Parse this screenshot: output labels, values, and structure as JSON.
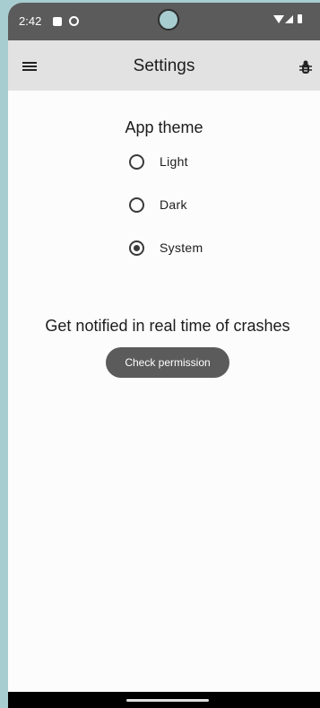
{
  "status_bar": {
    "time": "2:42",
    "icons": [
      "sd-card-icon",
      "sync-icon",
      "wifi-icon",
      "signal-icon",
      "battery-icon"
    ]
  },
  "app_bar": {
    "title": "Settings",
    "icons": [
      "menu-icon",
      "bug-icon"
    ]
  },
  "theme": {
    "title": "App theme",
    "options": [
      {
        "label": "Light",
        "selected": false
      },
      {
        "label": "Dark",
        "selected": false
      },
      {
        "label": "System",
        "selected": true
      }
    ]
  },
  "notifications": {
    "text": "Get notified in real time of crashes",
    "button_label": "Check permission"
  },
  "colors": {
    "status_bar": "#5b5b5b",
    "app_bar": "#e2e2e2",
    "background": "#fcfcfc",
    "button": "#5b5b5b",
    "frame": "#a7cdd0"
  }
}
